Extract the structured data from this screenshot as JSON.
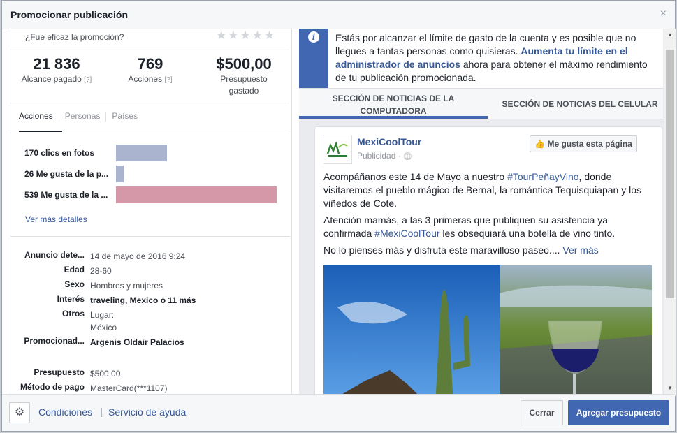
{
  "dialog": {
    "title": "Promocionar publicación",
    "close": "×"
  },
  "left": {
    "question": "¿Fue eficaz la promoción?",
    "stars": "★★★★★",
    "stats": [
      {
        "value": "21 836",
        "label": "Alcance pagado",
        "help": "[?]"
      },
      {
        "value": "769",
        "label": "Acciones",
        "help": "[?]"
      },
      {
        "value": "$500,00",
        "label": "Presupuesto",
        "label2": "gastado"
      }
    ],
    "tabs": [
      "Acciones",
      "Personas",
      "Países"
    ],
    "actions": [
      {
        "label": "170 clics en fotos",
        "value": 170,
        "color": "#aab4cf"
      },
      {
        "label": "26 Me gusta de la p...",
        "value": 26,
        "color": "#aab4cf"
      },
      {
        "label": "539 Me gusta de la ...",
        "value": 539,
        "color": "#d598a8"
      }
    ],
    "more_details": "Ver más detalles",
    "details": [
      {
        "key": "Anuncio dete...",
        "value": "14 de mayo de 2016 9:24"
      },
      {
        "key": "Edad",
        "value": "28-60"
      },
      {
        "key": "Sexo",
        "value": "Hombres y mujeres"
      },
      {
        "key": "Interés",
        "value": "traveling, Mexico o 11 más"
      },
      {
        "key": "Otros",
        "value": "Lugar:",
        "value2": "México"
      },
      {
        "key": "Promocionad...",
        "value": "Argenis Oldair Palacios"
      },
      {
        "key": "Presupuesto",
        "value": "$500,00"
      },
      {
        "key": "Método de pago",
        "value": "MasterCard(***1107)"
      }
    ]
  },
  "notice": {
    "text_before": "Estás por alcanzar el límite de gasto de la cuenta y es posible que no llegues a tantas personas como quisieras. ",
    "link": "Aumenta tu límite en el administrador de anuncios",
    "text_after": " ahora para obtener el máximo rendimiento de tu publicación promocionada."
  },
  "preview_tabs": [
    "SECCIÓN DE NOTICIAS DE LA COMPUTADORA",
    "SECCIÓN DE NOTICIAS DEL CELULAR"
  ],
  "post": {
    "page_name": "MexiCoolTour",
    "sponsored": "Publicidad · ",
    "globe": "🌐",
    "like_button": "Me gusta esta página",
    "p1_before": "Acompáñanos este 14 de Mayo a nuestro ",
    "p1_tag": "#TourPeñayVino",
    "p1_after": ", donde visitaremos el pueblo mágico de Bernal, la romántica Tequisquiapan y los viñedos de Cote.",
    "p2_before": "Atención mamás, a las 3 primeras que publiquen su asistencia ya confirmada ",
    "p2_tag": "#MexiCoolTour",
    "p2_after": " les obsequiará una botella de vino tinto.",
    "p3": "No lo pienses más y disfruta este maravilloso paseo.... ",
    "p3_more": "Ver más"
  },
  "footer": {
    "settings_icon": "⚙",
    "link_terms": "Condiciones",
    "sep": "|",
    "link_help": "Servicio de ayuda",
    "cancel": "Cerrar",
    "add_budget": "Agregar presupuesto"
  }
}
